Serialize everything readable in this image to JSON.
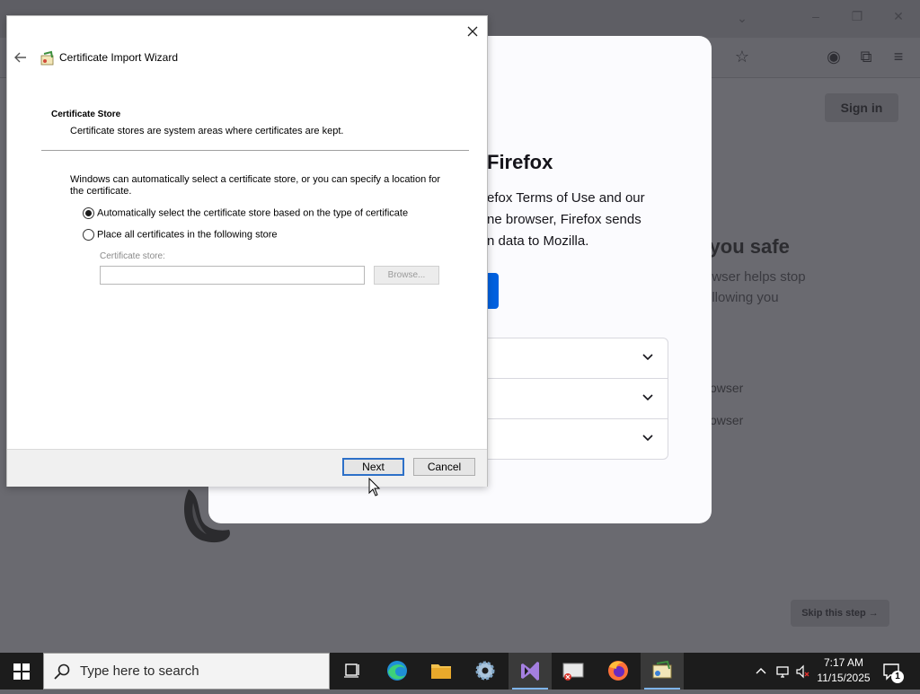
{
  "firefox_onboarding": {
    "title": "Firefox",
    "line1": "efox Terms of Use and our",
    "line2": "ne browser, Firefox sends",
    "line3": "n data to Mozilla."
  },
  "browser_background": {
    "sign_in": "Sign in",
    "safe_heading": "g you safe",
    "safe_line1": "owser helps stop",
    "safe_line2": "ollowing you",
    "option1": "owser",
    "option2": "owser",
    "skip": "Skip this step →"
  },
  "wizard": {
    "title": "Certificate Import Wizard",
    "section_title": "Certificate Store",
    "section_desc": "Certificate stores are system areas where certificates are kept.",
    "intro": "Windows can automatically select a certificate store, or you can specify a location for the certificate.",
    "radio_auto_label": "Automatically select the certificate store based on the type of certificate",
    "radio_manual_label": "Place all certificates in the following store",
    "radio_selected": "auto",
    "store_label": "Certificate store:",
    "store_value": "",
    "browse_label": "Browse...",
    "next_label": "Next",
    "cancel_label": "Cancel"
  },
  "taskbar": {
    "search_placeholder": "Type here to search",
    "time": "7:17 AM",
    "date": "11/15/2025",
    "notification_count": "1",
    "apps": [
      "task-view",
      "edge",
      "file-explorer",
      "settings",
      "visual-studio",
      "network-app",
      "firefox",
      "certificate-manager"
    ]
  },
  "colors": {
    "firefox_blue": "#0061e0",
    "taskbar_bg": "#1c1c1c",
    "dim_overlay": "#6a6a70",
    "focus_border": "#2d70c8"
  }
}
